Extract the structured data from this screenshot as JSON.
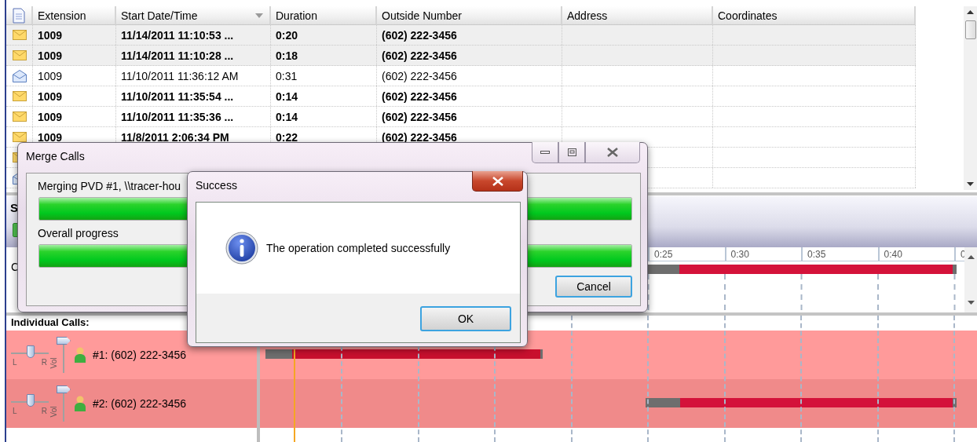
{
  "table": {
    "columns": [
      {
        "label": "Extension",
        "sorted": false
      },
      {
        "label": "Start Date/Time",
        "sorted": true
      },
      {
        "label": "Duration",
        "sorted": false
      },
      {
        "label": "Outside Number",
        "sorted": false
      },
      {
        "label": "Address",
        "sorted": false
      },
      {
        "label": "Coordinates",
        "sorted": false
      }
    ],
    "rows": [
      {
        "kind": "closed",
        "unread": true,
        "selected": true,
        "cells": [
          "1009",
          "11/14/2011 11:10:53 ...",
          "0:20",
          "(602) 222-3456"
        ]
      },
      {
        "kind": "closed",
        "unread": true,
        "selected": true,
        "cells": [
          "1009",
          "11/14/2011 11:10:28 ...",
          "0:18",
          "(602) 222-3456"
        ]
      },
      {
        "kind": "open",
        "unread": false,
        "selected": false,
        "cells": [
          "1009",
          "11/10/2011 11:36:12 AM",
          "0:31",
          "(602) 222-3456"
        ]
      },
      {
        "kind": "closed",
        "unread": true,
        "selected": false,
        "cells": [
          "1009",
          "11/10/2011 11:35:54 ...",
          "0:14",
          "(602) 222-3456"
        ]
      },
      {
        "kind": "closed",
        "unread": true,
        "selected": false,
        "cells": [
          "1009",
          "11/10/2011 11:35:36 ...",
          "0:14",
          "(602) 222-3456"
        ]
      },
      {
        "kind": "closed",
        "unread": true,
        "selected": false,
        "cells": [
          "1009",
          "11/8/2011 2:06:34 PM",
          "0:22",
          "(602) 222-3456"
        ]
      },
      {
        "kind": "closed",
        "selected": false
      },
      {
        "kind": "open",
        "selected": false
      }
    ]
  },
  "details": {
    "header_fragment": "S",
    "label_fragment": "C"
  },
  "timeline": {
    "ticks": [
      "0:25",
      "0:30",
      "0:35",
      "0:40",
      "0"
    ]
  },
  "individual_calls": {
    "title": "Individual Calls:",
    "calls": [
      {
        "label": "#1: (602) 222-3456",
        "balance": {
          "level": 0.5,
          "left_label": "L",
          "right_label": "R"
        },
        "volume": {
          "level": 1,
          "label": "Vol"
        }
      },
      {
        "label": "#2: (602) 222-3456",
        "balance": {
          "level": 0.5,
          "left_label": "L",
          "right_label": "R"
        },
        "volume": {
          "level": 1,
          "label": "Vol"
        }
      }
    ]
  },
  "merge_dialog": {
    "title": "Merge Calls",
    "tasks": [
      {
        "label": "Merging PVD #1, \\\\tracer-hou",
        "level": 1
      },
      {
        "label": "Overall progress",
        "level": 1
      }
    ],
    "cancel": "Cancel"
  },
  "success_dialog": {
    "title": "Success",
    "message": "The operation completed successfully",
    "ok": "OK"
  }
}
